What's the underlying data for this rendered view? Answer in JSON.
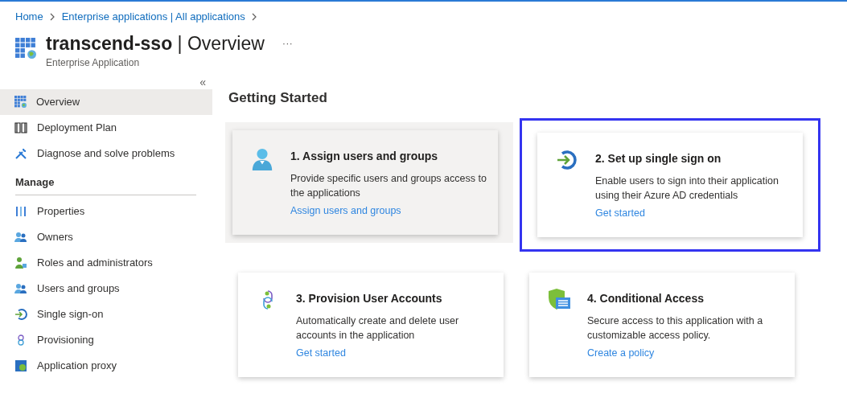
{
  "breadcrumb": [
    {
      "label": "Home"
    },
    {
      "label": "Enterprise applications | All applications"
    }
  ],
  "header": {
    "title_bold": "transcend-sso",
    "title_rest": "| Overview",
    "more": "···",
    "subtitle": "Enterprise Application"
  },
  "sidebar": {
    "collapse": "«",
    "items": [
      {
        "label": "Overview",
        "selected": true
      },
      {
        "label": "Deployment Plan",
        "selected": false
      },
      {
        "label": "Diagnose and solve problems",
        "selected": false
      }
    ],
    "sections": [
      {
        "title": "Manage",
        "items": [
          {
            "label": "Properties",
            "selected": false
          },
          {
            "label": "Owners",
            "selected": false
          },
          {
            "label": "Roles and administrators",
            "selected": false
          },
          {
            "label": "Users and groups",
            "selected": false
          },
          {
            "label": "Single sign-on",
            "selected": false
          },
          {
            "label": "Provisioning",
            "selected": false
          },
          {
            "label": "Application proxy",
            "selected": false
          }
        ]
      }
    ]
  },
  "main": {
    "heading": "Getting Started",
    "cards": [
      {
        "title": "1. Assign users and groups",
        "description": "Provide specific users and groups access to the applications",
        "link": "Assign users and groups",
        "hovered": true,
        "highlighted": false
      },
      {
        "title": "2. Set up single sign on",
        "description": "Enable users to sign into their application using their Azure AD credentials",
        "link": "Get started",
        "hovered": false,
        "highlighted": true
      },
      {
        "title": "3. Provision User Accounts",
        "description": "Automatically create and delete user accounts in the application",
        "link": "Get started",
        "hovered": false,
        "highlighted": false
      },
      {
        "title": "4. Conditional Access",
        "description": "Secure access to this application with a customizable access policy.",
        "link": "Create a policy",
        "hovered": false,
        "highlighted": false
      }
    ]
  }
}
